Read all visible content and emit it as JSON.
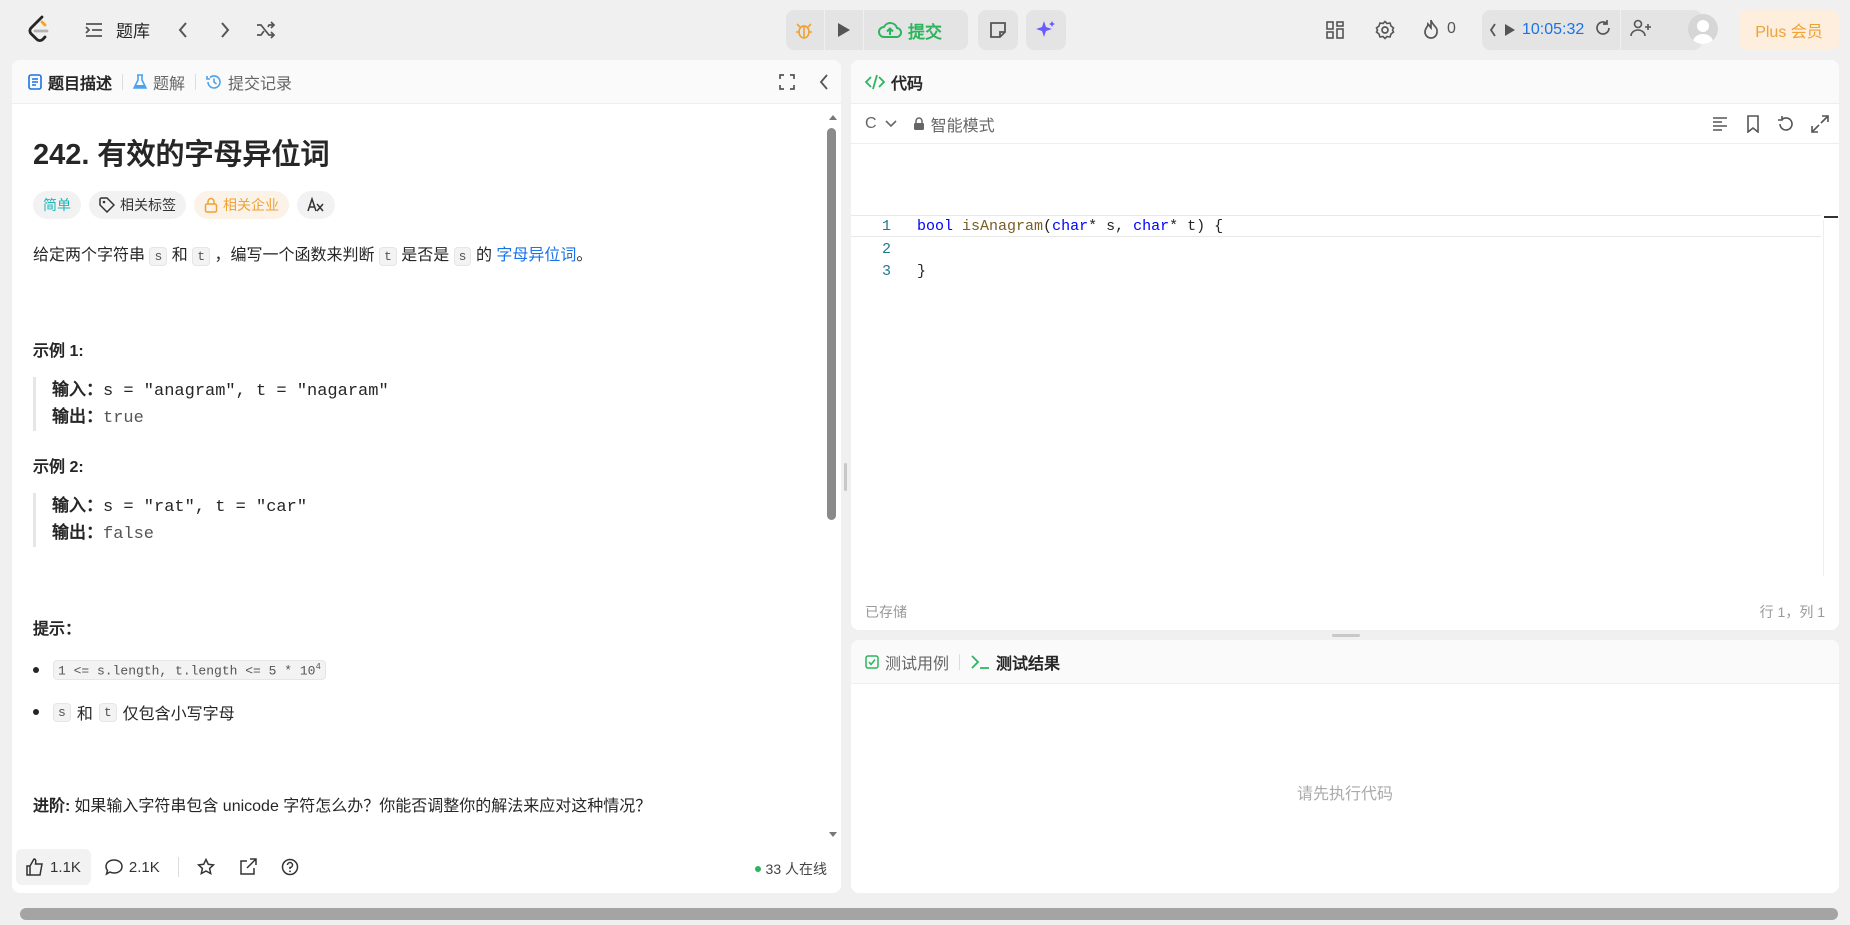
{
  "header": {
    "problem_list": "题库",
    "submit": "提交",
    "streak": "0",
    "timer": "10:05:32",
    "plus": "Plus 会员"
  },
  "left_tabs": {
    "description": "题目描述",
    "solutions": "题解",
    "submissions": "提交记录"
  },
  "problem": {
    "title": "242. 有效的字母异位词",
    "tags": {
      "difficulty": "简单",
      "topics": "相关标签",
      "companies": "相关企业"
    },
    "desc_pre": "给定两个字符串",
    "desc_s": "s",
    "desc_and": "和",
    "desc_t": "t",
    "desc_mid": "，编写一个函数来判断",
    "desc_t2": "t",
    "desc_is": "是否是",
    "desc_s2": "s",
    "desc_of": "的",
    "desc_link": "字母异位词",
    "desc_end": "。",
    "example1_title": "示例 1:",
    "example1_in_label": "输入：",
    "example1_in": "s = \"anagram\", t = \"nagaram\"",
    "example1_out_label": "输出：",
    "example1_out": "true",
    "example2_title": "示例 2:",
    "example2_in_label": "输入：",
    "example2_in": "s = \"rat\", t = \"car\"",
    "example2_out_label": "输出：",
    "example2_out": "false",
    "hints_title": "提示：",
    "hint1": "1 <= s.length, t.length <= 5 * 10",
    "hint1_sup": "4",
    "hint2_s": "s",
    "hint2_and": "和",
    "hint2_t": "t",
    "hint2_rest": "仅包含小写字母",
    "advanced_label": "进阶:",
    "advanced_text": "如果输入字符串包含 unicode 字符怎么办？你能否调整你的解法来应对这种情况？"
  },
  "footer": {
    "likes": "1.1K",
    "comments": "2.1K",
    "online": "33 人在线"
  },
  "code_panel": {
    "title": "代码",
    "language": "C",
    "mode": "智能模式",
    "lines": [
      {
        "no": "1",
        "text": ""
      },
      {
        "no": "2",
        "text": ""
      },
      {
        "no": "3",
        "text": "}"
      }
    ],
    "line1": {
      "kw": "bool",
      "fn": "isAnagram",
      "p1": "(",
      "t1": "char",
      "p2": "* s, ",
      "t2": "char",
      "p3": "* t) {"
    },
    "saved": "已存储",
    "cursor": "行 1，列 1"
  },
  "result_panel": {
    "testcase_tab": "测试用例",
    "result_tab": "测试结果",
    "empty_text": "请先执行代码"
  }
}
